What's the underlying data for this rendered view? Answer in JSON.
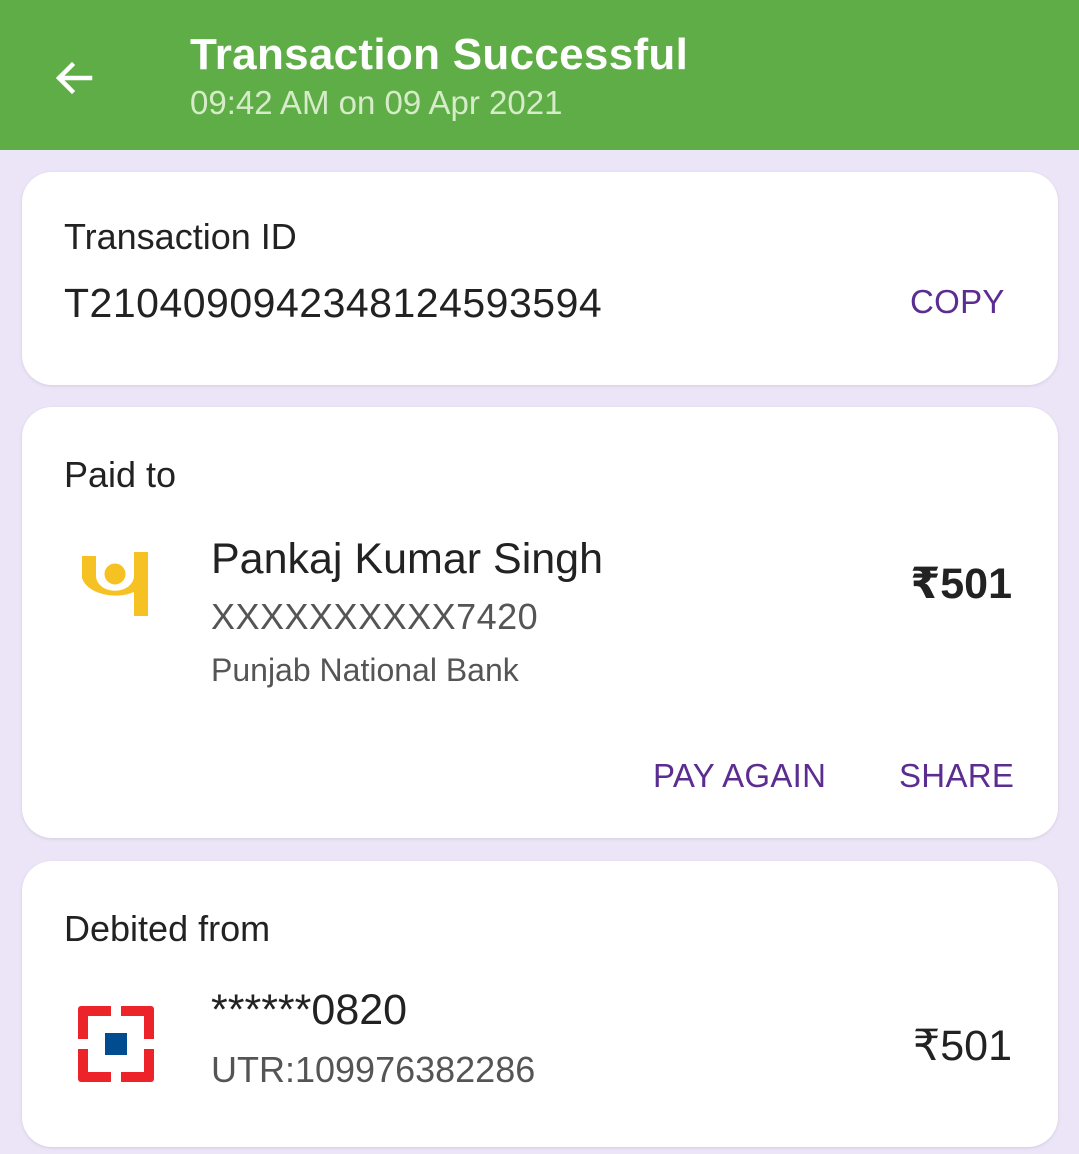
{
  "header": {
    "title": "Transaction Successful",
    "subtitle": "09:42 AM on 09 Apr 2021"
  },
  "transaction": {
    "label": "Transaction ID",
    "id": "T2104090942348124593594",
    "copy_label": "COPY"
  },
  "paid_to": {
    "label": "Paid to",
    "name": "Pankaj Kumar Singh",
    "account": "XXXXXXXXXX7420",
    "bank": "Punjab National Bank",
    "amount": "₹501",
    "pay_again_label": "PAY AGAIN",
    "share_label": "SHARE"
  },
  "debited_from": {
    "label": "Debited from",
    "account": "******0820",
    "utr": "UTR:109976382286",
    "amount": "₹501"
  },
  "colors": {
    "header_bg": "#5fad46",
    "accent": "#5c2d91",
    "page_bg": "#ece4f7"
  },
  "icons": {
    "back": "arrow-left-icon",
    "payee_bank": "pnb-logo-icon",
    "payer_bank": "hdfc-logo-icon"
  }
}
